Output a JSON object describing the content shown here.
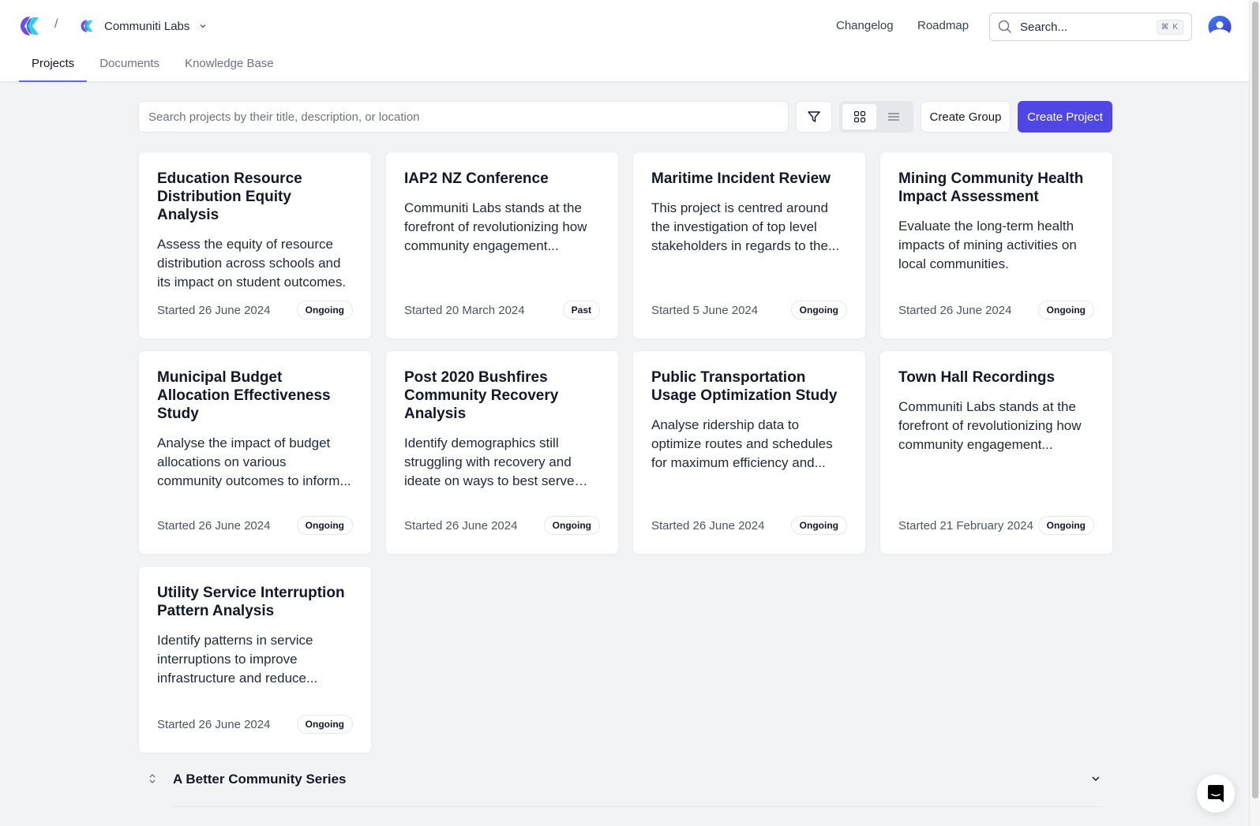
{
  "header": {
    "org_name": "Communiti Labs",
    "links": [
      "Changelog",
      "Roadmap"
    ],
    "search_placeholder": "Search...",
    "search_shortcut": "⌘ K"
  },
  "tabs": [
    {
      "label": "Projects",
      "active": true
    },
    {
      "label": "Documents",
      "active": false
    },
    {
      "label": "Knowledge Base",
      "active": false
    }
  ],
  "toolbar": {
    "search_placeholder": "Search projects by their title, description, or location",
    "view_mode": "grid",
    "create_group_label": "Create Group",
    "create_project_label": "Create Project"
  },
  "colors": {
    "accent": "#4f46e5",
    "tab_underline": "#6366f1",
    "background": "#f2f3f5"
  },
  "projects": [
    {
      "title": "Education Resource Distribution Equity Analysis",
      "description": "Assess the equity of resource distribution across schools and its impact on student outcomes.",
      "started": "Started 26 June 2024",
      "status": "Ongoing"
    },
    {
      "title": "IAP2 NZ Conference",
      "description": "Communiti Labs stands at the forefront of revolutionizing how community engagement...",
      "started": "Started 20 March 2024",
      "status": "Past"
    },
    {
      "title": "Maritime Incident Review",
      "description": "This project is centred around the investigation of top level stakeholders in regards to the...",
      "started": "Started 5 June 2024",
      "status": "Ongoing"
    },
    {
      "title": "Mining Community Health Impact Assessment",
      "description": "Evaluate the long-term health impacts of mining activities on local communities.",
      "started": "Started 26 June 2024",
      "status": "Ongoing"
    },
    {
      "title": "Municipal Budget Allocation Effectiveness Study",
      "description": "Analyse the impact of budget allocations on various community outcomes to inform...",
      "started": "Started 26 June 2024",
      "status": "Ongoing"
    },
    {
      "title": "Post 2020 Bushfires Community Recovery Analysis",
      "description": "Identify demographics still struggling with recovery and ideate on ways to best serve th...",
      "started": "Started 26 June 2024",
      "status": "Ongoing"
    },
    {
      "title": "Public Transportation Usage Optimization Study",
      "description": "Analyse ridership data to optimize routes and schedules for maximum efficiency and...",
      "started": "Started 26 June 2024",
      "status": "Ongoing"
    },
    {
      "title": "Town Hall Recordings",
      "description": "Communiti Labs stands at the forefront of revolutionizing how community engagement...",
      "started": "Started 21 February 2024",
      "status": "Ongoing"
    },
    {
      "title": "Utility Service Interruption Pattern Analysis",
      "description": "Identify patterns in service interruptions to improve infrastructure and reduce...",
      "started": "Started 26 June 2024",
      "status": "Ongoing"
    }
  ],
  "group": {
    "title": "A Better Community Series"
  }
}
